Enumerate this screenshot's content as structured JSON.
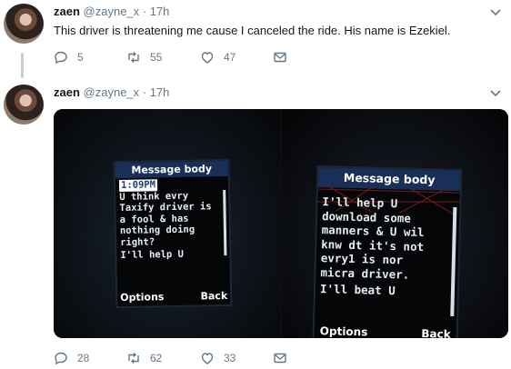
{
  "tweets": [
    {
      "name": "zaen",
      "handle": "@zayne_x · 17h",
      "text": "This driver is threatening me cause I canceled the ride. His name is Ezekiel.",
      "replies": "5",
      "retweets": "55",
      "likes": "47"
    },
    {
      "name": "zaen",
      "handle": "@zayne_x · 17h",
      "text": "",
      "replies": "28",
      "retweets": "62",
      "likes": "33"
    }
  ],
  "phone_left": {
    "title": "Message body",
    "time": "1:09PM",
    "lines": [
      "U think evry",
      "Taxify driver is",
      "a fool & has",
      "nothing doing",
      "right?",
      "I'll help U"
    ],
    "soft_left": "Options",
    "soft_right": "Back"
  },
  "phone_right": {
    "title": "Message body",
    "lines": [
      "I'll help U",
      "download some",
      "manners & U wil",
      "knw dt it's not",
      "evry1 is nor",
      "micra driver.",
      "I'll beat U"
    ],
    "soft_left": "Options",
    "soft_right": "Back"
  },
  "icons": [
    "reply-icon",
    "retweet-icon",
    "like-icon",
    "message-icon",
    "chevron-down-icon"
  ],
  "colors": {
    "text": "#14171a",
    "muted": "#657786",
    "thread_line": "#c4cfd6",
    "screen_title": "#1a2f58"
  }
}
